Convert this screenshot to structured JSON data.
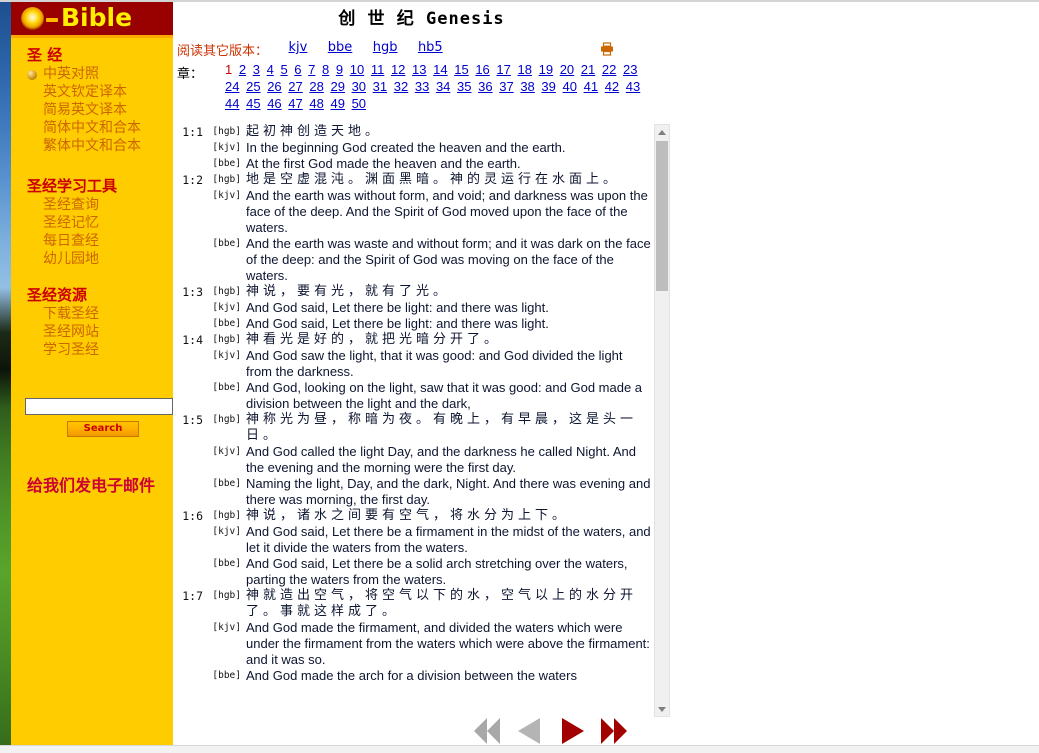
{
  "brand": {
    "name": "Bible",
    "sun_icon": "sun-orb-icon"
  },
  "sidebar": {
    "sections": [
      {
        "heading": "圣 经",
        "items": [
          {
            "label": "中英对照",
            "bullet": true
          },
          {
            "label": "英文钦定译本",
            "bullet": false
          },
          {
            "label": "简易英文译本",
            "bullet": false
          },
          {
            "label": "简体中文和合本",
            "bullet": false
          },
          {
            "label": "繁体中文和合本",
            "bullet": false
          }
        ]
      },
      {
        "heading": "圣经学习工具",
        "items": [
          {
            "label": "圣经查询",
            "bullet": false
          },
          {
            "label": "圣经记忆",
            "bullet": false
          },
          {
            "label": "每日查经",
            "bullet": false
          },
          {
            "label": "幼儿园地",
            "bullet": false
          }
        ]
      },
      {
        "heading": "圣经资源",
        "items": [
          {
            "label": "下载圣经",
            "bullet": false
          },
          {
            "label": "圣经网站",
            "bullet": false
          },
          {
            "label": "学习圣经",
            "bullet": false
          }
        ]
      }
    ],
    "search": {
      "value": "",
      "placeholder": "",
      "button_label": "Search"
    },
    "email_link": "给我们发电子邮件"
  },
  "content": {
    "book_title": "创 世 纪 Genesis",
    "versions_label": "阅读其它版本：",
    "versions": [
      "kjv",
      "bbe",
      "hgb",
      "hb5"
    ],
    "print_icon": "printer-icon",
    "chapters_label": "章：",
    "current_chapter": 1,
    "chapters": [
      1,
      2,
      3,
      4,
      5,
      6,
      7,
      8,
      9,
      10,
      11,
      12,
      13,
      14,
      15,
      16,
      17,
      18,
      19,
      20,
      21,
      22,
      23,
      24,
      25,
      26,
      27,
      28,
      29,
      30,
      31,
      32,
      33,
      34,
      35,
      36,
      37,
      38,
      39,
      40,
      41,
      42,
      43,
      44,
      45,
      46,
      47,
      48,
      49,
      50
    ],
    "verses": [
      {
        "ref": "1:1",
        "lines": [
          {
            "tag": "[hgb]",
            "lang": "cn",
            "text": "起初神创造天地。"
          },
          {
            "tag": "[kjv]",
            "lang": "en",
            "text": "In the beginning God created the heaven and the earth."
          },
          {
            "tag": "[bbe]",
            "lang": "en",
            "text": "At the first God made the heaven and the earth."
          }
        ]
      },
      {
        "ref": "1:2",
        "lines": [
          {
            "tag": "[hgb]",
            "lang": "cn",
            "text": "地是空虚混沌。渊面黑暗。神的灵运行在水面上。"
          },
          {
            "tag": "[kjv]",
            "lang": "en",
            "text": "And the earth was without form, and void; and darkness was upon the face of the deep. And the Spirit of God moved upon the face of the waters."
          },
          {
            "tag": "[bbe]",
            "lang": "en",
            "text": "And the earth was waste and without form; and it was dark on the face of the deep: and the Spirit of God was moving on the face of the waters."
          }
        ]
      },
      {
        "ref": "1:3",
        "lines": [
          {
            "tag": "[hgb]",
            "lang": "cn",
            "text": "神说，要有光，就有了光。"
          },
          {
            "tag": "[kjv]",
            "lang": "en",
            "text": "And God said, Let there be light: and there was light."
          },
          {
            "tag": "[bbe]",
            "lang": "en",
            "text": "And God said, Let there be light: and there was light."
          }
        ]
      },
      {
        "ref": "1:4",
        "lines": [
          {
            "tag": "[hgb]",
            "lang": "cn",
            "text": "神看光是好的，就把光暗分开了。"
          },
          {
            "tag": "[kjv]",
            "lang": "en",
            "text": "And God saw the light, that it was good: and God divided the light from the darkness."
          },
          {
            "tag": "[bbe]",
            "lang": "en",
            "text": "And God, looking on the light, saw that it was good: and God made a division between the light and the dark,"
          }
        ]
      },
      {
        "ref": "1:5",
        "lines": [
          {
            "tag": "[hgb]",
            "lang": "cn",
            "text": "神称光为昼，称暗为夜。有晚上，有早晨，这是头一日。"
          },
          {
            "tag": "[kjv]",
            "lang": "en",
            "text": "And God called the light Day, and the darkness he called Night. And the evening and the morning were the first day."
          },
          {
            "tag": "[bbe]",
            "lang": "en",
            "text": "Naming the light, Day, and the dark, Night. And there was evening and there was morning, the first day."
          }
        ]
      },
      {
        "ref": "1:6",
        "lines": [
          {
            "tag": "[hgb]",
            "lang": "cn",
            "text": "神说，诸水之间要有空气，将水分为上下。"
          },
          {
            "tag": "[kjv]",
            "lang": "en",
            "text": "And God said, Let there be a firmament in the midst of the waters, and let it divide the waters from the waters."
          },
          {
            "tag": "[bbe]",
            "lang": "en",
            "text": "And God said, Let there be a solid arch stretching over the waters, parting the waters from the waters."
          }
        ]
      },
      {
        "ref": "1:7",
        "lines": [
          {
            "tag": "[hgb]",
            "lang": "cn",
            "text": "神就造出空气，将空气以下的水，空气以上的水分开了。事就这样成了。"
          },
          {
            "tag": "[kjv]",
            "lang": "en",
            "text": "And God made the firmament, and divided the waters which were under the firmament from the waters which were above the firmament: and it was so."
          },
          {
            "tag": "[bbe]",
            "lang": "en",
            "text": "And God made the arch for a division between the waters"
          }
        ]
      }
    ],
    "nav_arrows": [
      {
        "name": "first-book-arrow",
        "icon": "double-left-arrow-icon",
        "color": "#a8a8a8"
      },
      {
        "name": "previous-chapter-arrow",
        "icon": "single-left-arrow-icon",
        "color": "#b4b4b4"
      },
      {
        "name": "next-chapter-arrow",
        "icon": "single-right-arrow-icon",
        "color": "#a30000"
      },
      {
        "name": "last-book-arrow",
        "icon": "double-right-arrow-icon",
        "color": "#a30000"
      }
    ]
  },
  "colors": {
    "sidebar_bg": "#ffcc00",
    "banner_bg": "#990000",
    "heading_red": "#cc0000",
    "link_orange": "#cc6600",
    "link_blue": "#0000cc",
    "current_red": "#cc0000"
  }
}
